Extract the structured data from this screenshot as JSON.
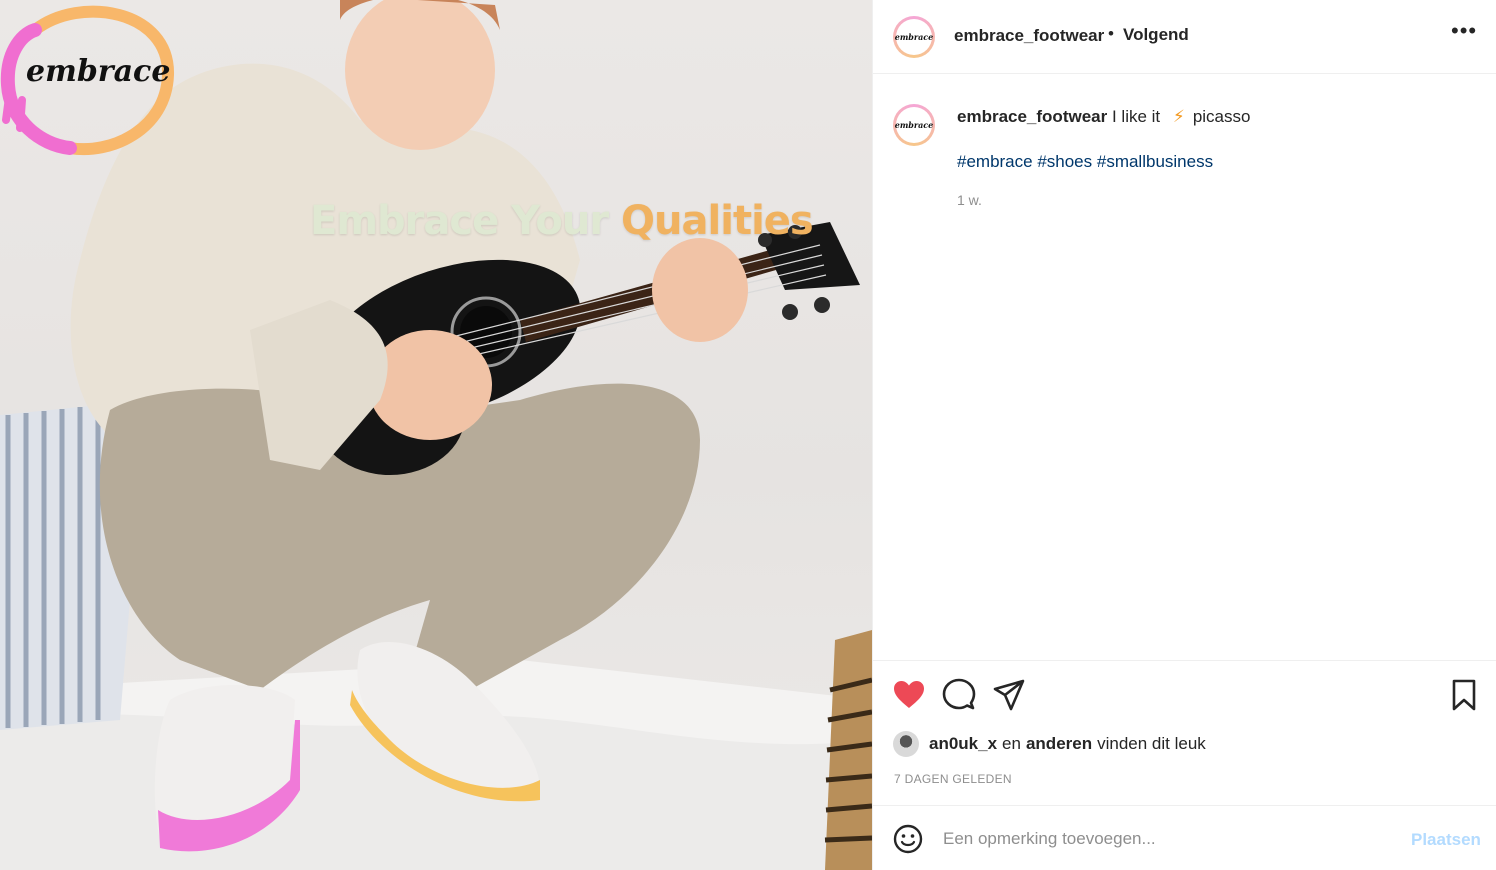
{
  "post": {
    "overlay_text": {
      "part1": "Embrace Your",
      "part2": "Qualities"
    },
    "brand_logo_text": "embrace"
  },
  "header": {
    "avatar_text": "embrace",
    "username": "embrace_footwear",
    "separator": "•",
    "follow_status": "Volgend",
    "more_label": "•••"
  },
  "caption": {
    "avatar_text": "embrace",
    "username": "embrace_footwear",
    "text": "I like it",
    "bolt": "⚡",
    "after_emoji": "picasso",
    "hashtags": "#embrace #shoes #smallbusiness",
    "age": "1 w."
  },
  "actions": {
    "like_icon": "heart-filled-icon",
    "comment_icon": "comment-icon",
    "share_icon": "share-icon",
    "save_icon": "bookmark-icon",
    "like_color": "#ed4956"
  },
  "likes": {
    "user": "an0uk_x",
    "conj": "en",
    "others": "anderen",
    "suffix": "vinden dit leuk"
  },
  "timestamp": "7 DAGEN GELEDEN",
  "comment": {
    "placeholder": "Een opmerking toevoegen...",
    "post_label": "Plaatsen"
  }
}
